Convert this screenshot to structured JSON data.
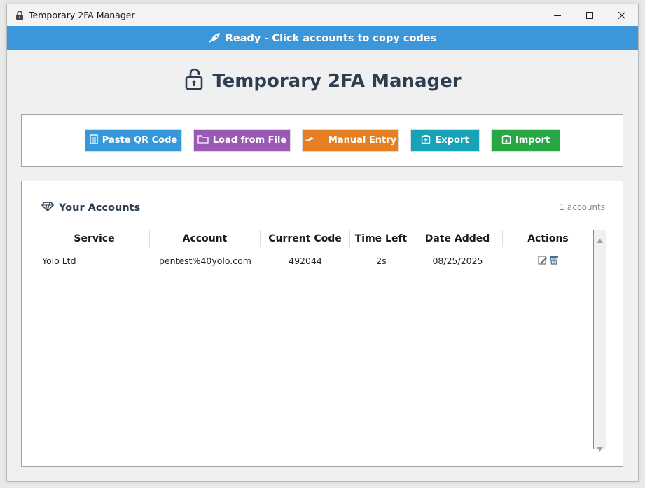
{
  "window": {
    "title": "Temporary 2FA Manager",
    "controls": [
      "minimize-icon",
      "maximize-icon",
      "close-icon"
    ]
  },
  "status": {
    "text": "Ready - Click accounts to copy codes",
    "icon": "rocket-icon",
    "color": "#3c97da"
  },
  "heading": {
    "text": "Temporary 2FA Manager",
    "icon": "unlock-icon"
  },
  "toolbar": {
    "buttons": [
      {
        "label": "Paste QR Code",
        "icon": "clipboard-icon",
        "color": "#3498db"
      },
      {
        "label": "Load from File",
        "icon": "folder-icon",
        "color": "#9b59b6"
      },
      {
        "label": "Manual Entry",
        "icon": "pencil-icon",
        "color": "#e67e22"
      },
      {
        "label": "Export",
        "icon": "export-icon",
        "color": "#17a2b8"
      },
      {
        "label": "Import",
        "icon": "import-icon",
        "color": "#28a745"
      }
    ]
  },
  "accounts": {
    "title": "Your Accounts",
    "icon": "gem-icon",
    "count": "1 accounts",
    "columns": [
      "Service",
      "Account",
      "Current Code",
      "Time Left",
      "Date Added",
      "Actions"
    ],
    "rows": [
      {
        "service": "Yolo Ltd",
        "account": "pentest%40yolo.com",
        "code": "492044",
        "time_left": "2s",
        "date_added": "08/25/2025",
        "actions": [
          "edit-icon",
          "delete-icon"
        ]
      }
    ]
  }
}
